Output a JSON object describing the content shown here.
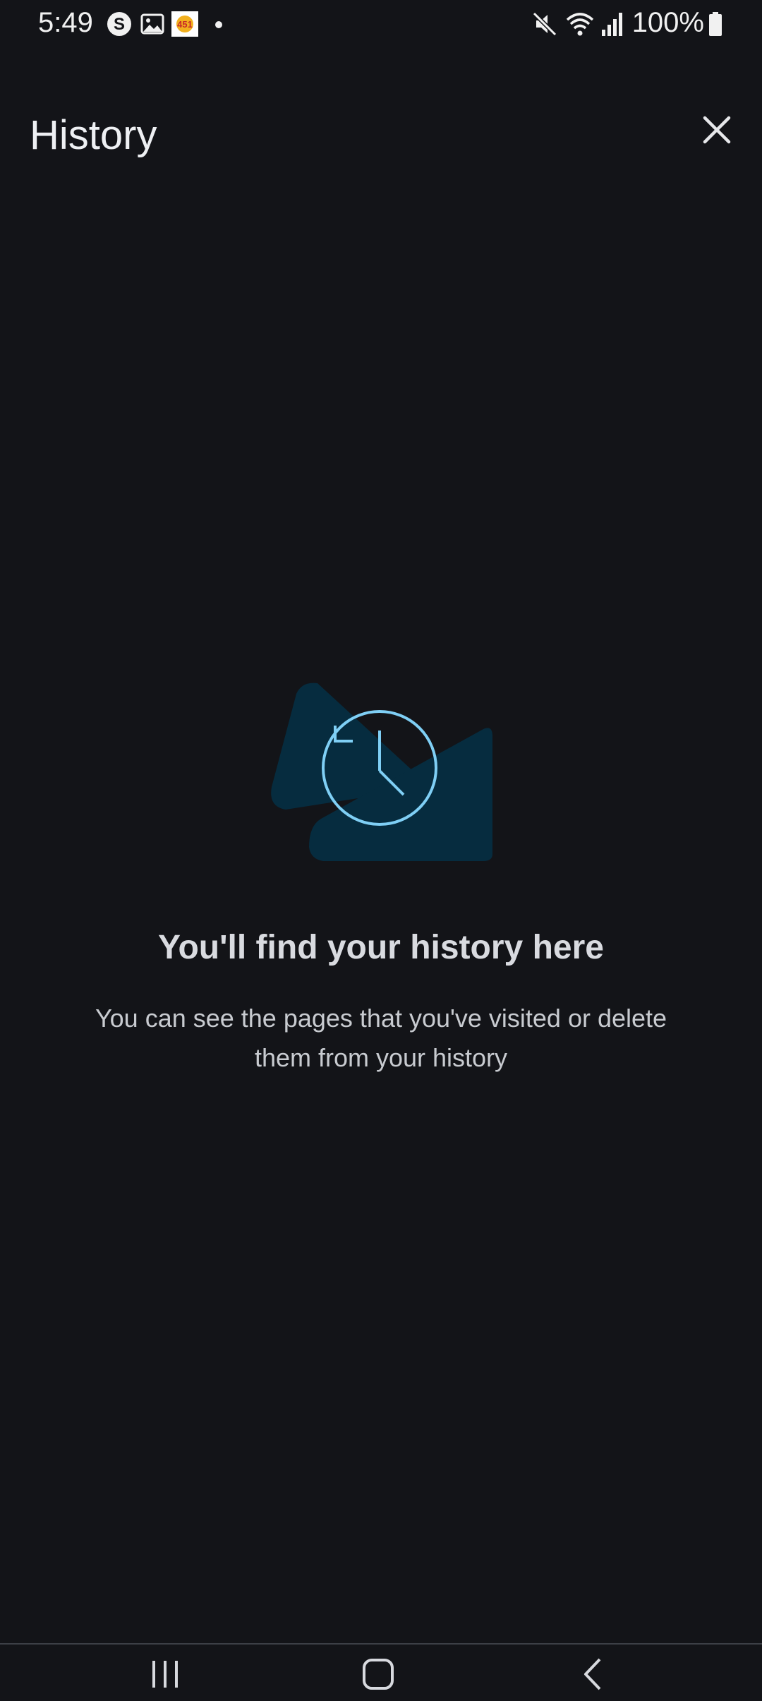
{
  "status_bar": {
    "time": "5:49",
    "battery_text": "100%",
    "icons_left": [
      "skype-icon",
      "gallery-icon",
      "app-badge-icon",
      "dot-icon"
    ],
    "icons_right": [
      "mute-icon",
      "wifi-icon",
      "signal-icon",
      "battery-icon"
    ]
  },
  "header": {
    "title": "History",
    "close_icon": "close-icon"
  },
  "empty_state": {
    "illustration_icon": "history-clock-icon",
    "title": "You'll find your history here",
    "body": "You can see the pages that you've visited or delete them from your history"
  },
  "nav_bar": {
    "recents_icon": "recents-icon",
    "home_icon": "home-icon",
    "back_icon": "back-icon"
  },
  "colors": {
    "background": "#131418",
    "illustration_shape": "#062c3f",
    "illustration_stroke": "#7fcff5"
  }
}
